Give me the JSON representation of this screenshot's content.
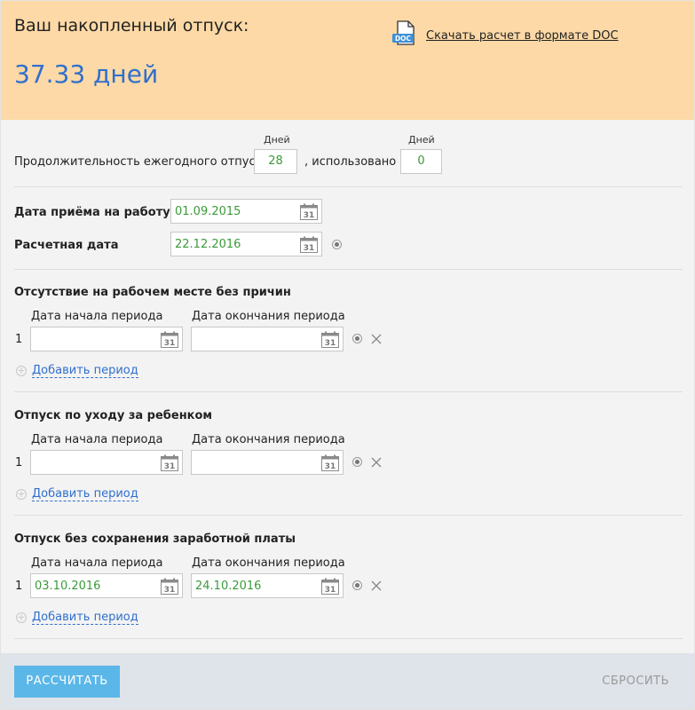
{
  "result": {
    "title": "Ваш накопленный отпуск:",
    "value": "37.33 дней",
    "doc_link": "Скачать расчет в формате DOC",
    "doc_badge": "DOC"
  },
  "vacation": {
    "duration_label": "Продолжительность ежегодного отпуска",
    "days_caption": "Дней",
    "duration_value": "28",
    "used_label": ", использовано",
    "used_caption": "Дней",
    "used_value": "0"
  },
  "employment": {
    "hire_label": "Дата приёма на работу",
    "hire_value": "01.09.2015",
    "calc_label": "Расчетная дата",
    "calc_value": "22.12.2016",
    "calendar_glyph": "31"
  },
  "sections": [
    {
      "title": "Отсутствие на рабочем месте без причин",
      "start_label": "Дата начала периода",
      "end_label": "Дата окончания периода",
      "row_num": "1",
      "start_value": "",
      "end_value": "",
      "add_label": "Добавить период"
    },
    {
      "title": "Отпуск по уходу за ребенком",
      "start_label": "Дата начала периода",
      "end_label": "Дата окончания периода",
      "row_num": "1",
      "start_value": "",
      "end_value": "",
      "add_label": "Добавить период"
    },
    {
      "title": "Отпуск без сохранения заработной платы",
      "start_label": "Дата начала периода",
      "end_label": "Дата окончания периода",
      "row_num": "1",
      "start_value": "03.10.2016",
      "end_value": "24.10.2016",
      "add_label": "Добавить период"
    }
  ],
  "footer": {
    "calc_button": "РАССЧИТАТЬ",
    "reset_button": "СБРОСИТЬ"
  },
  "colors": {
    "result_bg": "#fcd9a6",
    "accent_blue": "#2f6fce",
    "value_green": "#3a9a3a",
    "button_blue": "#5bb7e8",
    "footer_bg": "#dfe3ea"
  }
}
